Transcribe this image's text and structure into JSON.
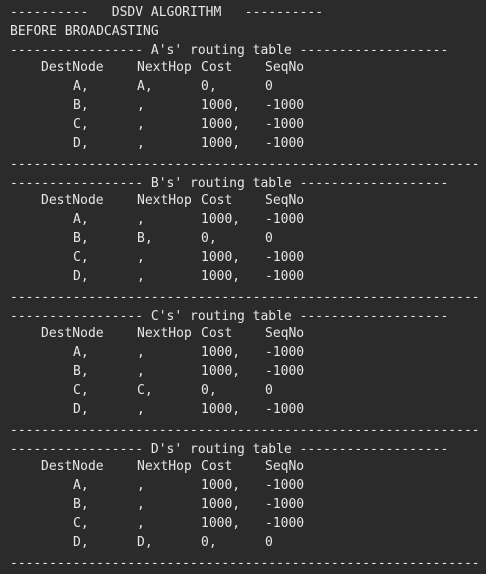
{
  "title_line": "----------   DSDV ALGORITHM   ----------",
  "phase_line": "BEFORE BROADCASTING",
  "headers": {
    "dest": "DestNode",
    "next": "NextHop",
    "cost": "Cost",
    "seq": "SeqNo"
  },
  "close_rule": "------------------------------------------------------------",
  "tables": [
    {
      "title": "----------------- A's' routing table -------------------",
      "rows": [
        {
          "dest": "A,",
          "next": "A,",
          "cost": "0,",
          "seq": "0"
        },
        {
          "dest": "B,",
          "next": ",",
          "cost": "1000,",
          "seq": "-1000"
        },
        {
          "dest": "C,",
          "next": ",",
          "cost": "1000,",
          "seq": "-1000"
        },
        {
          "dest": "D,",
          "next": ",",
          "cost": "1000,",
          "seq": "-1000"
        }
      ]
    },
    {
      "title": "----------------- B's' routing table -------------------",
      "rows": [
        {
          "dest": "A,",
          "next": ",",
          "cost": "1000,",
          "seq": "-1000"
        },
        {
          "dest": "B,",
          "next": "B,",
          "cost": "0,",
          "seq": "0"
        },
        {
          "dest": "C,",
          "next": ",",
          "cost": "1000,",
          "seq": "-1000"
        },
        {
          "dest": "D,",
          "next": ",",
          "cost": "1000,",
          "seq": "-1000"
        }
      ]
    },
    {
      "title": "----------------- C's' routing table -------------------",
      "rows": [
        {
          "dest": "A,",
          "next": ",",
          "cost": "1000,",
          "seq": "-1000"
        },
        {
          "dest": "B,",
          "next": ",",
          "cost": "1000,",
          "seq": "-1000"
        },
        {
          "dest": "C,",
          "next": "C,",
          "cost": "0,",
          "seq": "0"
        },
        {
          "dest": "D,",
          "next": ",",
          "cost": "1000,",
          "seq": "-1000"
        }
      ]
    },
    {
      "title": "----------------- D's' routing table -------------------",
      "rows": [
        {
          "dest": "A,",
          "next": ",",
          "cost": "1000,",
          "seq": "-1000"
        },
        {
          "dest": "B,",
          "next": ",",
          "cost": "1000,",
          "seq": "-1000"
        },
        {
          "dest": "C,",
          "next": ",",
          "cost": "1000,",
          "seq": "-1000"
        },
        {
          "dest": "D,",
          "next": "D,",
          "cost": "0,",
          "seq": "0"
        }
      ]
    }
  ]
}
